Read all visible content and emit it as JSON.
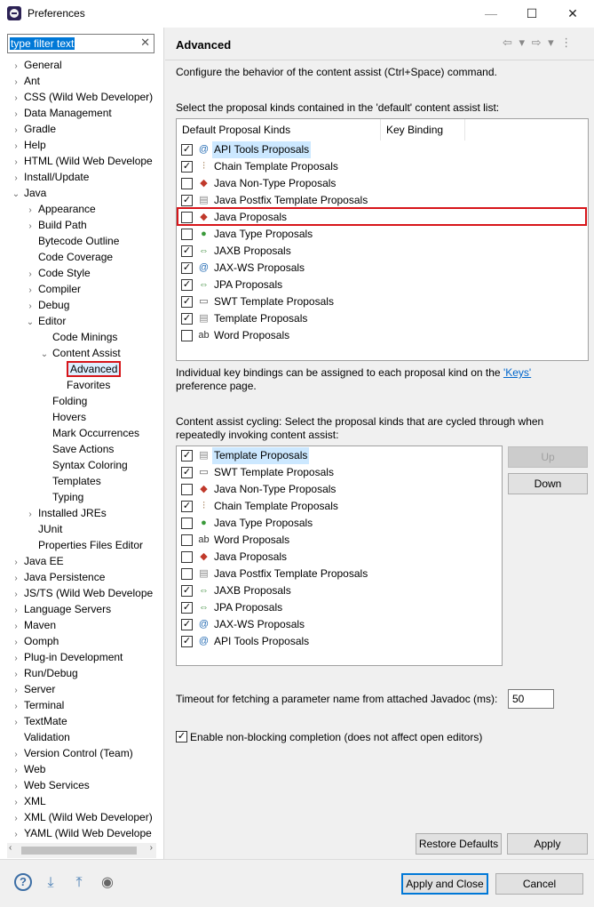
{
  "window": {
    "title": "Preferences",
    "minimize": "—",
    "maximize": "☐",
    "close": "✕"
  },
  "filter": {
    "value": "type filter text"
  },
  "tree": [
    {
      "label": "General",
      "tw": "›"
    },
    {
      "label": "Ant",
      "tw": "›"
    },
    {
      "label": "CSS (Wild Web Developer)",
      "tw": "›"
    },
    {
      "label": "Data Management",
      "tw": "›"
    },
    {
      "label": "Gradle",
      "tw": "›"
    },
    {
      "label": "Help",
      "tw": "›"
    },
    {
      "label": "HTML (Wild Web Develope",
      "tw": "›"
    },
    {
      "label": "Install/Update",
      "tw": "›"
    },
    {
      "label": "Java",
      "tw": "⌄"
    },
    {
      "label": "Appearance",
      "tw": "›"
    },
    {
      "label": "Build Path",
      "tw": "›"
    },
    {
      "label": "Bytecode Outline",
      "tw": ""
    },
    {
      "label": "Code Coverage",
      "tw": ""
    },
    {
      "label": "Code Style",
      "tw": "›"
    },
    {
      "label": "Compiler",
      "tw": "›"
    },
    {
      "label": "Debug",
      "tw": "›"
    },
    {
      "label": "Editor",
      "tw": "⌄"
    },
    {
      "label": "Code Minings",
      "tw": ""
    },
    {
      "label": "Content Assist",
      "tw": "⌄"
    },
    {
      "label": "Advanced",
      "tw": ""
    },
    {
      "label": "Favorites",
      "tw": ""
    },
    {
      "label": "Folding",
      "tw": ""
    },
    {
      "label": "Hovers",
      "tw": ""
    },
    {
      "label": "Mark Occurrences",
      "tw": ""
    },
    {
      "label": "Save Actions",
      "tw": ""
    },
    {
      "label": "Syntax Coloring",
      "tw": ""
    },
    {
      "label": "Templates",
      "tw": ""
    },
    {
      "label": "Typing",
      "tw": ""
    },
    {
      "label": "Installed JREs",
      "tw": "›"
    },
    {
      "label": "JUnit",
      "tw": ""
    },
    {
      "label": "Properties Files Editor",
      "tw": ""
    },
    {
      "label": "Java EE",
      "tw": "›"
    },
    {
      "label": "Java Persistence",
      "tw": "›"
    },
    {
      "label": "JS/TS (Wild Web Develope",
      "tw": "›"
    },
    {
      "label": "Language Servers",
      "tw": "›"
    },
    {
      "label": "Maven",
      "tw": "›"
    },
    {
      "label": "Oomph",
      "tw": "›"
    },
    {
      "label": "Plug-in Development",
      "tw": "›"
    },
    {
      "label": "Run/Debug",
      "tw": "›"
    },
    {
      "label": "Server",
      "tw": "›"
    },
    {
      "label": "Terminal",
      "tw": "›"
    },
    {
      "label": "TextMate",
      "tw": "›"
    },
    {
      "label": "Validation",
      "tw": ""
    },
    {
      "label": "Version Control (Team)",
      "tw": "›"
    },
    {
      "label": "Web",
      "tw": "›"
    },
    {
      "label": "Web Services",
      "tw": "›"
    },
    {
      "label": "XML",
      "tw": "›"
    },
    {
      "label": "XML (Wild Web Developer)",
      "tw": "›"
    },
    {
      "label": "YAML (Wild Web Develope",
      "tw": "›"
    }
  ],
  "main": {
    "title": "Advanced",
    "nav": "⇦ ▾ ⇨ ▾ ⋮",
    "intro": "Configure the behavior of the content assist (Ctrl+Space) command.",
    "default_list_label": "Select the proposal kinds contained in the 'default' content assist list:",
    "col_kinds": "Default Proposal Kinds",
    "col_binding": "Key Binding",
    "default_kinds": [
      {
        "label": "API Tools Proposals",
        "checked": true,
        "icon": "@",
        "color": "#2a6fb5"
      },
      {
        "label": "Chain Template Proposals",
        "checked": true,
        "icon": "⫶",
        "color": "#8a5a2a"
      },
      {
        "label": "Java Non-Type Proposals",
        "checked": false,
        "icon": "◆",
        "color": "#c0392b"
      },
      {
        "label": "Java Postfix Template Proposals",
        "checked": true,
        "icon": "▤",
        "color": "#888888"
      },
      {
        "label": "Java Proposals",
        "checked": false,
        "icon": "◆",
        "color": "#c0392b"
      },
      {
        "label": "Java Type Proposals",
        "checked": false,
        "icon": "●",
        "color": "#3a9a3a"
      },
      {
        "label": "JAXB Proposals",
        "checked": true,
        "icon": "⇔",
        "color": "#3a8a3a"
      },
      {
        "label": "JAX-WS Proposals",
        "checked": true,
        "icon": "@",
        "color": "#2a6fb5"
      },
      {
        "label": "JPA Proposals",
        "checked": true,
        "icon": "⇔",
        "color": "#3a8a3a"
      },
      {
        "label": "SWT Template Proposals",
        "checked": true,
        "icon": "▭",
        "color": "#555555"
      },
      {
        "label": "Template Proposals",
        "checked": true,
        "icon": "▤",
        "color": "#888888"
      },
      {
        "label": "Word Proposals",
        "checked": false,
        "icon": "ab",
        "color": "#333333"
      }
    ],
    "keys_note_1": "Individual key bindings can be assigned to each proposal kind on the",
    "keys_link": "'Keys'",
    "keys_note_2": "preference page.",
    "cycling_label_1": "Content assist cycling: Select the proposal kinds that are cycled through when",
    "cycling_label_2": "repeatedly invoking content assist:",
    "cycling_kinds": [
      {
        "label": "Template Proposals",
        "checked": true,
        "icon": "▤",
        "color": "#888888"
      },
      {
        "label": "SWT Template Proposals",
        "checked": true,
        "icon": "▭",
        "color": "#555555"
      },
      {
        "label": "Java Non-Type Proposals",
        "checked": false,
        "icon": "◆",
        "color": "#c0392b"
      },
      {
        "label": "Chain Template Proposals",
        "checked": true,
        "icon": "⫶",
        "color": "#8a5a2a"
      },
      {
        "label": "Java Type Proposals",
        "checked": false,
        "icon": "●",
        "color": "#3a9a3a"
      },
      {
        "label": "Word Proposals",
        "checked": false,
        "icon": "ab",
        "color": "#333333"
      },
      {
        "label": "Java Proposals",
        "checked": false,
        "icon": "◆",
        "color": "#c0392b"
      },
      {
        "label": "Java Postfix Template Proposals",
        "checked": false,
        "icon": "▤",
        "color": "#888888"
      },
      {
        "label": "JAXB Proposals",
        "checked": true,
        "icon": "⇔",
        "color": "#3a8a3a"
      },
      {
        "label": "JPA Proposals",
        "checked": true,
        "icon": "⇔",
        "color": "#3a8a3a"
      },
      {
        "label": "JAX-WS Proposals",
        "checked": true,
        "icon": "@",
        "color": "#2a6fb5"
      },
      {
        "label": "API Tools Proposals",
        "checked": true,
        "icon": "@",
        "color": "#2a6fb5"
      }
    ],
    "up_label": "Up",
    "down_label": "Down",
    "timeout_label": "Timeout for fetching a parameter name from attached Javadoc (ms):",
    "timeout_value": "50",
    "nonblocking_label": "Enable non-blocking completion (does not affect open editors)",
    "nonblocking_checked": true,
    "restore_label": "Restore Defaults",
    "apply_label": "Apply"
  },
  "footer": {
    "apply_close_label": "Apply and Close",
    "cancel_label": "Cancel"
  },
  "check_mark": "✓"
}
